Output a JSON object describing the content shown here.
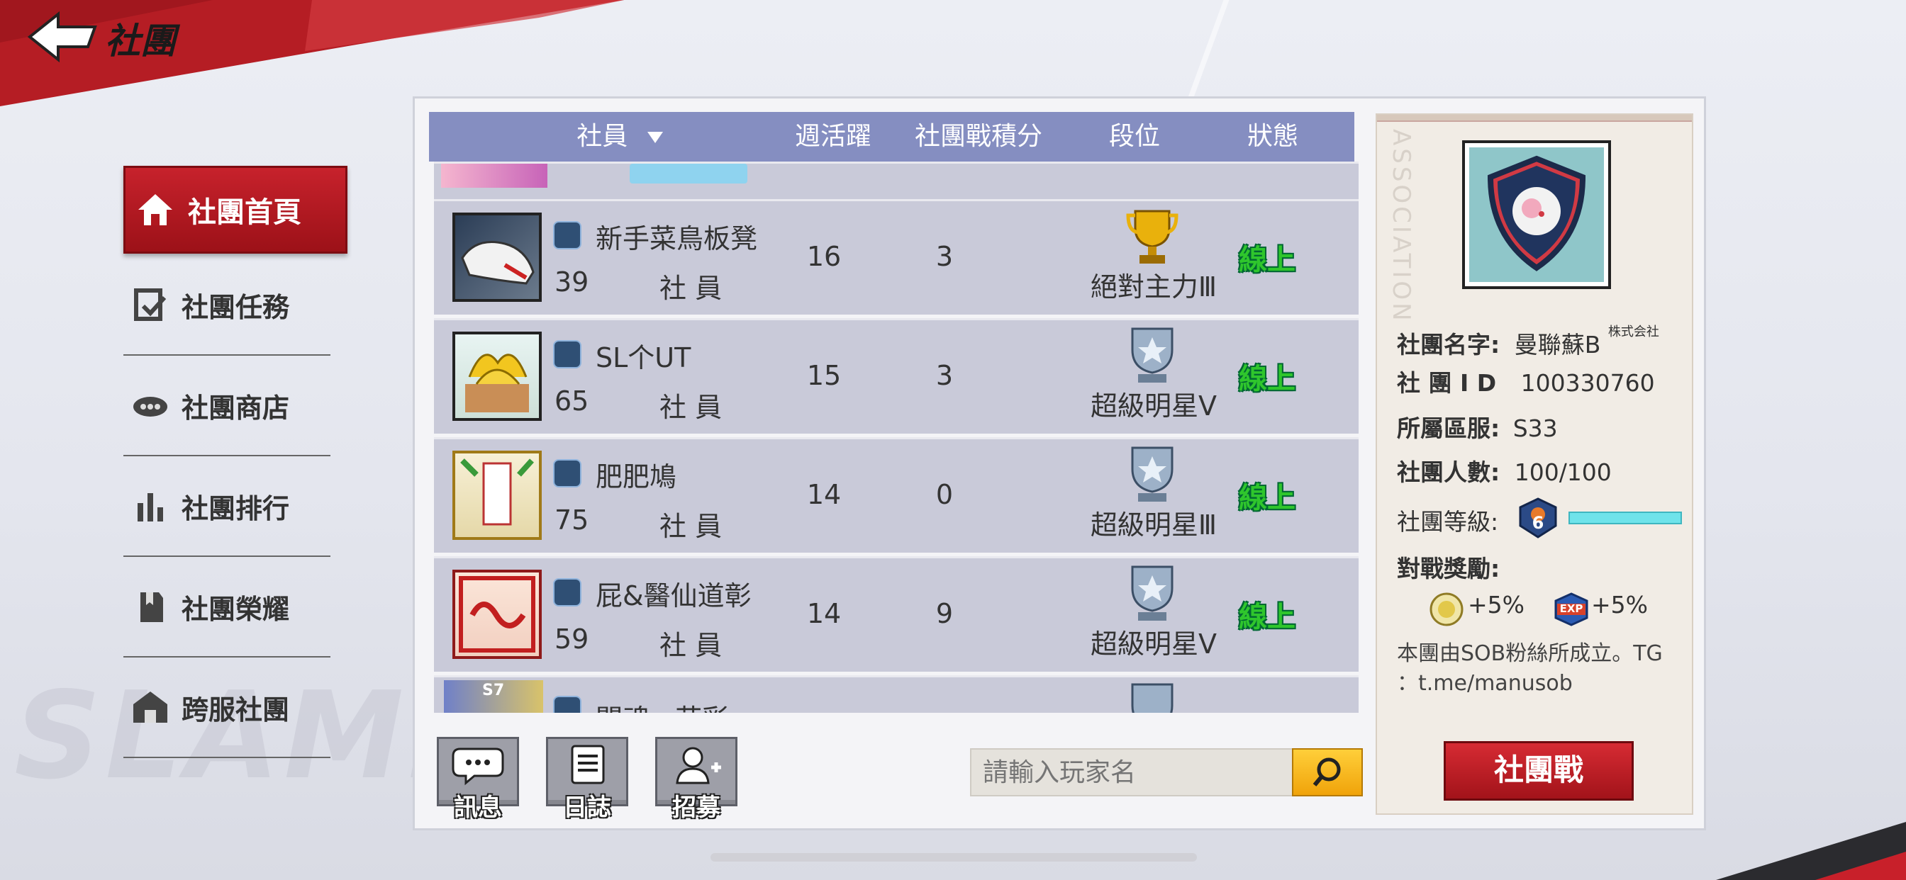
{
  "header": {
    "title": "社團"
  },
  "nav": {
    "active": "社團首頁",
    "items": [
      "社團任務",
      "社團商店",
      "社團排行",
      "社團榮耀",
      "跨服社團"
    ]
  },
  "table": {
    "headers": [
      "社員",
      "週活躍",
      "社團戰積分",
      "段位",
      "狀態"
    ],
    "rows": [
      {
        "name": "新手菜鳥板凳",
        "level": "39",
        "role": "社 員",
        "weekly": "16",
        "points": "3",
        "rank": "絕對主力Ⅲ",
        "status": "線上"
      },
      {
        "name": "SL个UT",
        "level": "65",
        "role": "社 員",
        "weekly": "15",
        "points": "3",
        "rank": "超級明星Ⅴ",
        "status": "線上"
      },
      {
        "name": "肥肥鳩",
        "level": "75",
        "role": "社 員",
        "weekly": "14",
        "points": "0",
        "rank": "超級明星Ⅲ",
        "status": "線上"
      },
      {
        "name": "屁&醫仙道彰",
        "level": "59",
        "role": "社 員",
        "weekly": "14",
        "points": "9",
        "rank": "超級明星Ⅴ",
        "status": "線上"
      }
    ],
    "partial_bottom": {
      "name": "闘魂 · 花彩",
      "level_badge": "S7"
    }
  },
  "toolbar": {
    "message": "訊息",
    "log": "日誌",
    "recruit": "招募"
  },
  "search": {
    "placeholder": "請輸入玩家名"
  },
  "info": {
    "watermark": "ASSOCIATION",
    "name_label": "社團名字:",
    "name_value": "曼聯蘇B",
    "name_suffix": "株式会社",
    "id_label": "社 團 I D",
    "id_value": "100330760",
    "server_label": "所屬區服:",
    "server_value": "S33",
    "members_label": "社團人數:",
    "members_value": "100/100",
    "level_label": "社團等級:",
    "level_value": "6",
    "reward_label": "對戰獎勵:",
    "reward_gold": "+5%",
    "reward_exp": "+5%",
    "exp_icon": "EXP",
    "description_line1": "本團由SOB粉絲所成立。TG",
    "description_line2": "：t.me/manusob"
  },
  "war_button": "社團戰",
  "watermark_text": "SLAMDUNK"
}
